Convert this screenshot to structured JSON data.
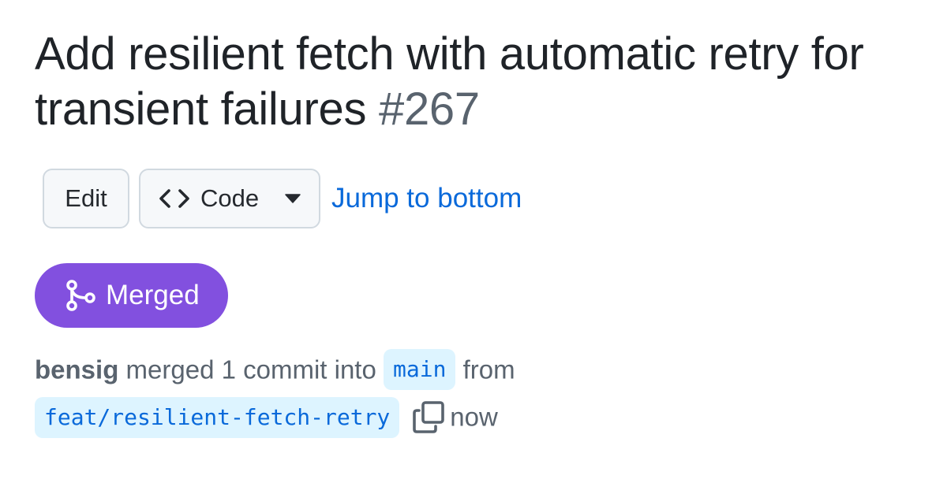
{
  "pull_request": {
    "title": "Add resilient fetch with automatic retry for transient failures",
    "number": "#267"
  },
  "actions": {
    "edit_label": "Edit",
    "code_label": "Code",
    "jump_label": "Jump to bottom"
  },
  "state": {
    "label": "Merged",
    "color": "#8250df",
    "icon": "git-merge-icon"
  },
  "merge_info": {
    "author": "bensig",
    "action_text": "merged 1 commit into",
    "base_branch": "main",
    "from_text": "from",
    "head_branch": "feat/resilient-fetch-retry",
    "time": "now",
    "copy_icon": "copy-icon"
  },
  "colors": {
    "link": "#0969da",
    "muted": "#59636e",
    "branch_bg": "#ddf4ff"
  }
}
